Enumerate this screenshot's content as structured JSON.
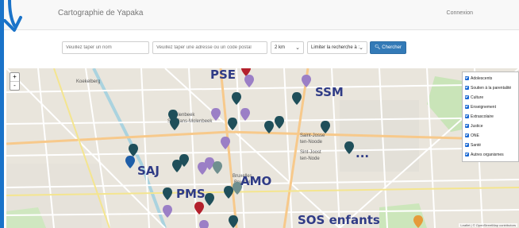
{
  "header": {
    "brand": "Cartographie de Yapaka",
    "login": "Connexion"
  },
  "search": {
    "name_placeholder": "Veuillez taper un nom",
    "address_placeholder": "Veuillez taper une adresse ou un code postal",
    "distance": "2 km",
    "limit_label": "Limiter la recherche à :",
    "button": "Chercher"
  },
  "map": {
    "labels": {
      "pse": "PSE",
      "ssm": "SSM",
      "saj": "SAJ",
      "pms": "PMS",
      "amo": "AMO",
      "sos": "SOS enfants",
      "ellipsis": "..."
    },
    "places": {
      "koekelberg": "Koekelberg",
      "molenbeek1": "Molenbeek",
      "molenbeek2": "Sint-Jans-Molenbeek",
      "bruxelles1": "Bruxelles",
      "bruxelles2": "Brussel",
      "stjosse1": "Saint-Josse",
      "stjosse2": "ten-Noode",
      "stjosse3": "Sint-Joost",
      "stjosse4": "ten-Node"
    },
    "attribution": "Leaflet | © OpenStreetMap contributors",
    "zoom_in": "+",
    "zoom_out": "-"
  },
  "legend": {
    "items": [
      "Adolescents",
      "Soutien à la parentalité",
      "Culture",
      "Enseignement",
      "Extrascolaire",
      "Justice",
      "ONE",
      "Santé",
      "Autres organismes"
    ],
    "checkbox_color": "#1967d2"
  },
  "colors": {
    "marker_teal": "#1f4f5a",
    "marker_purple": "#9b7fc6",
    "marker_blue": "#1f5ea8",
    "marker_red": "#b3202c",
    "label_color": "#2f3b86",
    "accent": "#337ab7"
  }
}
